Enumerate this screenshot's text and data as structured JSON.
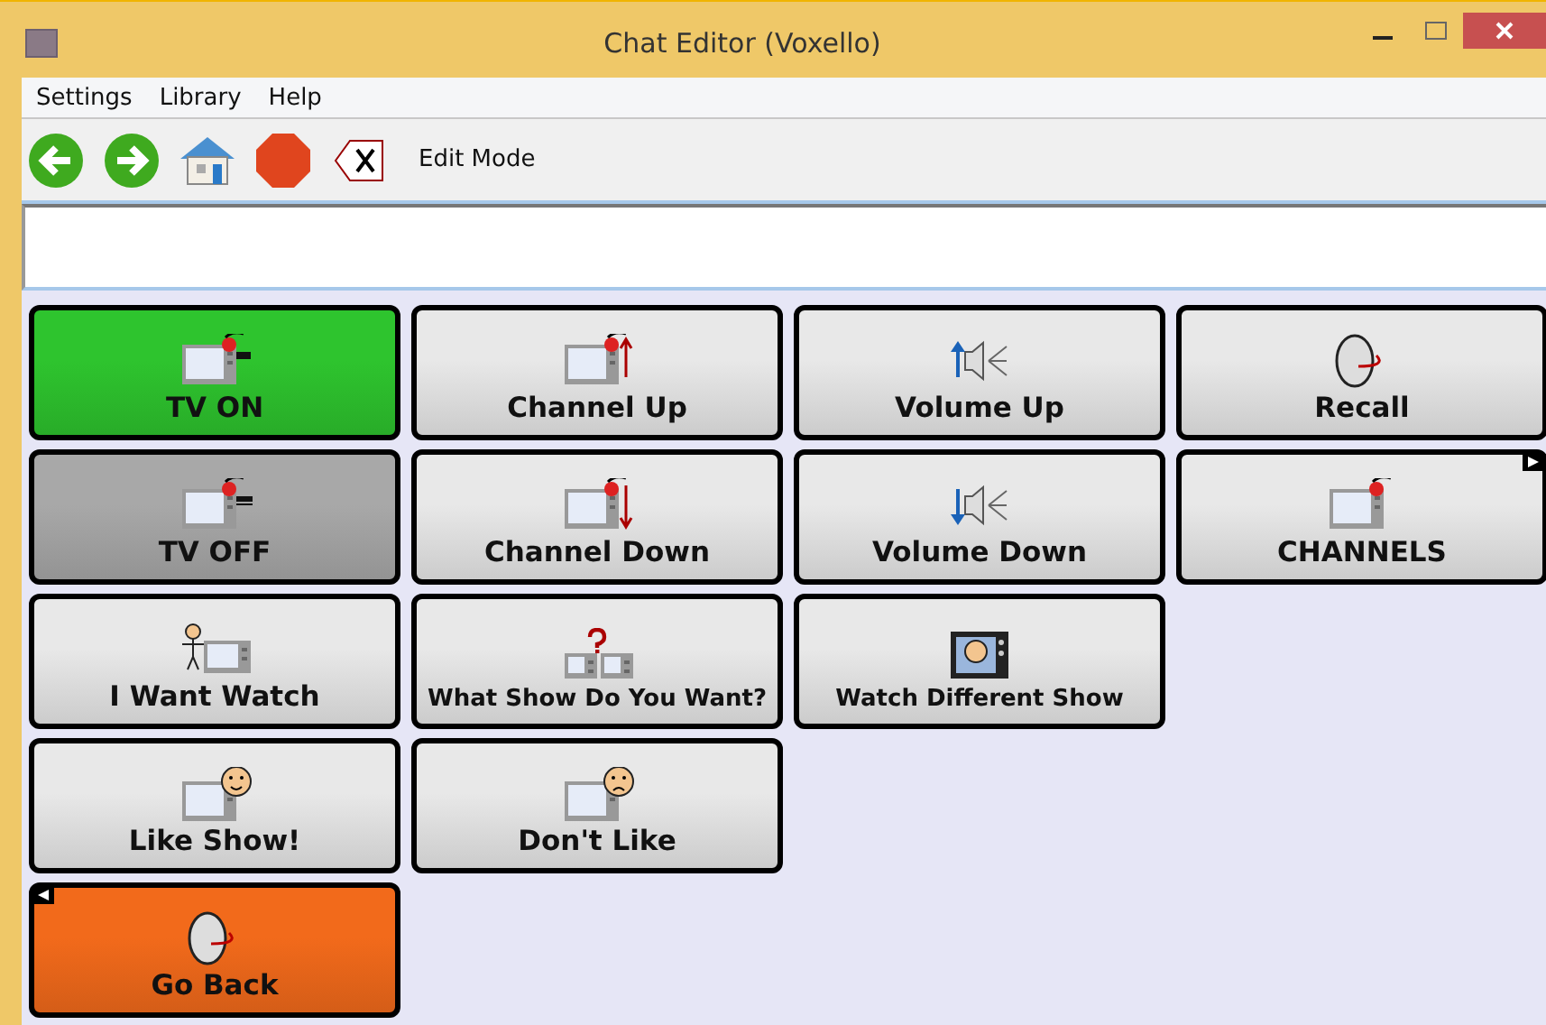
{
  "window": {
    "title": "Chat Editor (Voxello)"
  },
  "menu": [
    "Settings",
    "Library",
    "Help"
  ],
  "toolbar": {
    "mode_label": "Edit Mode"
  },
  "rows": [
    [
      {
        "label": "TV ON",
        "color": "#2ec42e",
        "kind": "tv-on"
      },
      {
        "label": "Channel Up",
        "color": "#e8e8e8",
        "kind": "channel-up"
      },
      {
        "label": "Volume Up",
        "color": "#e8e8e8",
        "kind": "volume-up"
      },
      {
        "label": "Recall",
        "color": "#e8e8e8",
        "kind": "disc"
      }
    ],
    [
      {
        "label": "TV OFF",
        "color": "#a8a8a8",
        "kind": "tv-off"
      },
      {
        "label": "Channel Down",
        "color": "#e8e8e8",
        "kind": "channel-down"
      },
      {
        "label": "Volume Down",
        "color": "#e8e8e8",
        "kind": "volume-down"
      },
      {
        "label": "CHANNELS",
        "color": "#e8e8e8",
        "kind": "tv",
        "opens_folder": true
      }
    ],
    [
      {
        "label": "I Want Watch",
        "color": "#e8e8e8",
        "kind": "want"
      },
      {
        "label": "What Show Do You Want?",
        "color": "#e8e8e8",
        "kind": "question"
      },
      {
        "label": "Watch Different Show",
        "color": "#e8e8e8",
        "kind": "show"
      }
    ],
    [
      {
        "label": "Like Show!",
        "color": "#e8e8e8",
        "kind": "like"
      },
      {
        "label": "Don't Like",
        "color": "#e8e8e8",
        "kind": "dislike"
      }
    ],
    [
      {
        "label": "Go Back",
        "color": "#f26a1b",
        "kind": "disc",
        "goes_back": true
      }
    ]
  ]
}
